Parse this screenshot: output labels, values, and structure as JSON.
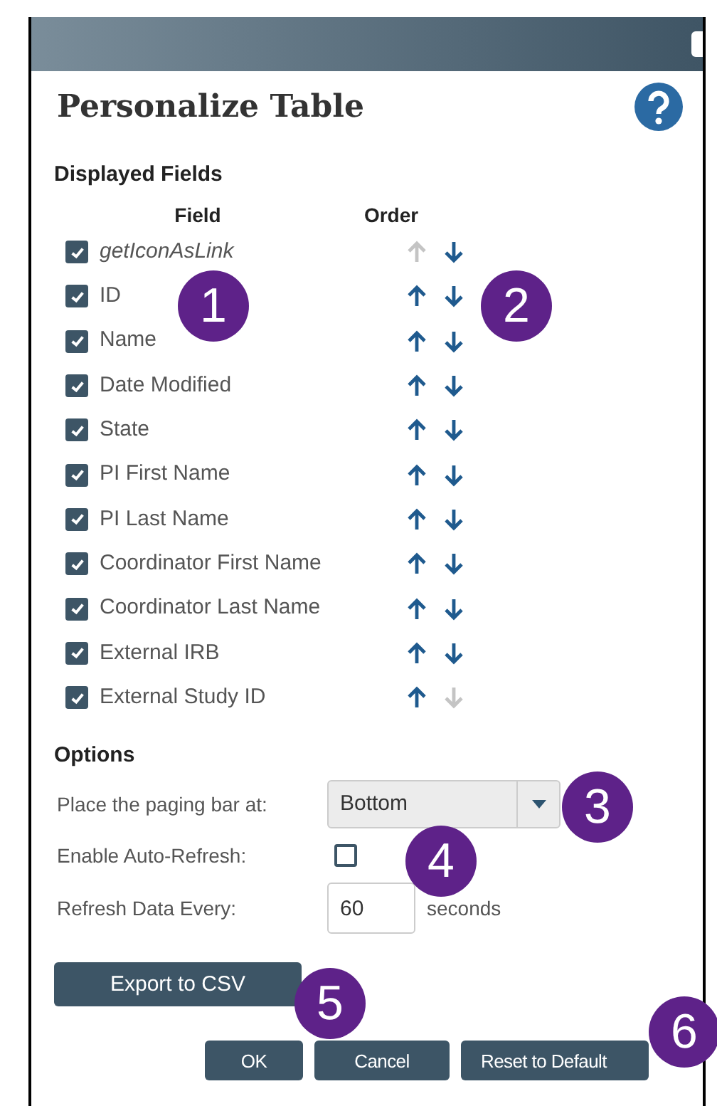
{
  "dialog": {
    "title": "Personalize Table"
  },
  "displayed_fields": {
    "heading": "Displayed Fields",
    "columns": [
      "Field",
      "Order"
    ],
    "rows": [
      {
        "label": "getIconAsLink",
        "italic": true,
        "checked": true,
        "up_disabled": true,
        "down_disabled": false
      },
      {
        "label": "ID",
        "italic": false,
        "checked": true,
        "up_disabled": false,
        "down_disabled": false
      },
      {
        "label": "Name",
        "italic": false,
        "checked": true,
        "up_disabled": false,
        "down_disabled": false
      },
      {
        "label": "Date Modified",
        "italic": false,
        "checked": true,
        "up_disabled": false,
        "down_disabled": false
      },
      {
        "label": "State",
        "italic": false,
        "checked": true,
        "up_disabled": false,
        "down_disabled": false
      },
      {
        "label": "PI First Name",
        "italic": false,
        "checked": true,
        "up_disabled": false,
        "down_disabled": false
      },
      {
        "label": "PI Last Name",
        "italic": false,
        "checked": true,
        "up_disabled": false,
        "down_disabled": false
      },
      {
        "label": "Coordinator First Name",
        "italic": false,
        "checked": true,
        "up_disabled": false,
        "down_disabled": false
      },
      {
        "label": "Coordinator Last Name",
        "italic": false,
        "checked": true,
        "up_disabled": false,
        "down_disabled": false
      },
      {
        "label": "External IRB",
        "italic": false,
        "checked": true,
        "up_disabled": false,
        "down_disabled": false
      },
      {
        "label": "External Study ID",
        "italic": false,
        "checked": true,
        "up_disabled": false,
        "down_disabled": true
      }
    ]
  },
  "options": {
    "heading": "Options",
    "paging_label": "Place the paging bar at:",
    "paging_value": "Bottom",
    "auto_refresh_label": "Enable Auto-Refresh:",
    "auto_refresh_checked": false,
    "refresh_label": "Refresh Data Every:",
    "refresh_value": "60",
    "refresh_unit": "seconds"
  },
  "export_button": "Export to CSV",
  "buttons": [
    "OK",
    "Cancel",
    "Reset to Default"
  ],
  "callouts": [
    "1",
    "2",
    "3",
    "4",
    "5",
    "6"
  ]
}
